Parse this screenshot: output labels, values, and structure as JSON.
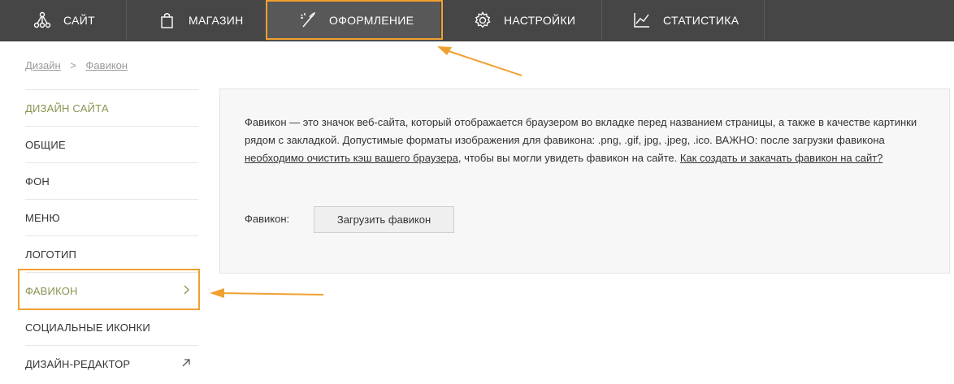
{
  "nav": {
    "items": [
      {
        "label": "САЙТ",
        "icon": "site-network-icon"
      },
      {
        "label": "МАГАЗИН",
        "icon": "shopping-bag-icon"
      },
      {
        "label": "ОФОРМЛЕНИЕ",
        "icon": "magic-wand-icon"
      },
      {
        "label": "НАСТРОЙКИ",
        "icon": "gear-icon"
      },
      {
        "label": "СТАТИСТИКА",
        "icon": "line-chart-icon"
      }
    ],
    "active_index": 2
  },
  "breadcrumb": {
    "root": "Дизайн",
    "separator": ">",
    "current": "Фавикон"
  },
  "sidebar": {
    "heading": "ДИЗАЙН САЙТА",
    "items": [
      {
        "label": "ОБЩИЕ"
      },
      {
        "label": "ФОН"
      },
      {
        "label": "МЕНЮ"
      },
      {
        "label": "ЛОГОТИП"
      },
      {
        "label": "ФАВИКОН",
        "icon": "chevron-right-icon"
      },
      {
        "label": "СОЦИАЛЬНЫЕ ИКОНКИ"
      },
      {
        "label": "ДИЗАЙН-РЕДАКТОР",
        "icon": "external-arrow-icon"
      }
    ],
    "active_index": 4
  },
  "content": {
    "text_part1": "Фавикон — это значок веб-сайта, который отображается браузером во вкладке перед названием страницы, а также в качестве картинки рядом с закладкой. Допустимые форматы изображения для фавикона: .png, .gif, jpg, .jpeg, .ico. ВАЖНО: после загрузки фавикона ",
    "link_cache": "необходимо очистить кэш вашего браузера",
    "text_part2": ", чтобы вы могли увидеть фавикон на сайте. ",
    "link_howto": "Как создать и закачать фавикон на сайт?",
    "favicon_label": "Фавикон:",
    "upload_button": "Загрузить фавикон"
  },
  "colors": {
    "topbar": "#464646",
    "accent_olive": "#8a9450",
    "highlight_orange": "#f0a030"
  }
}
